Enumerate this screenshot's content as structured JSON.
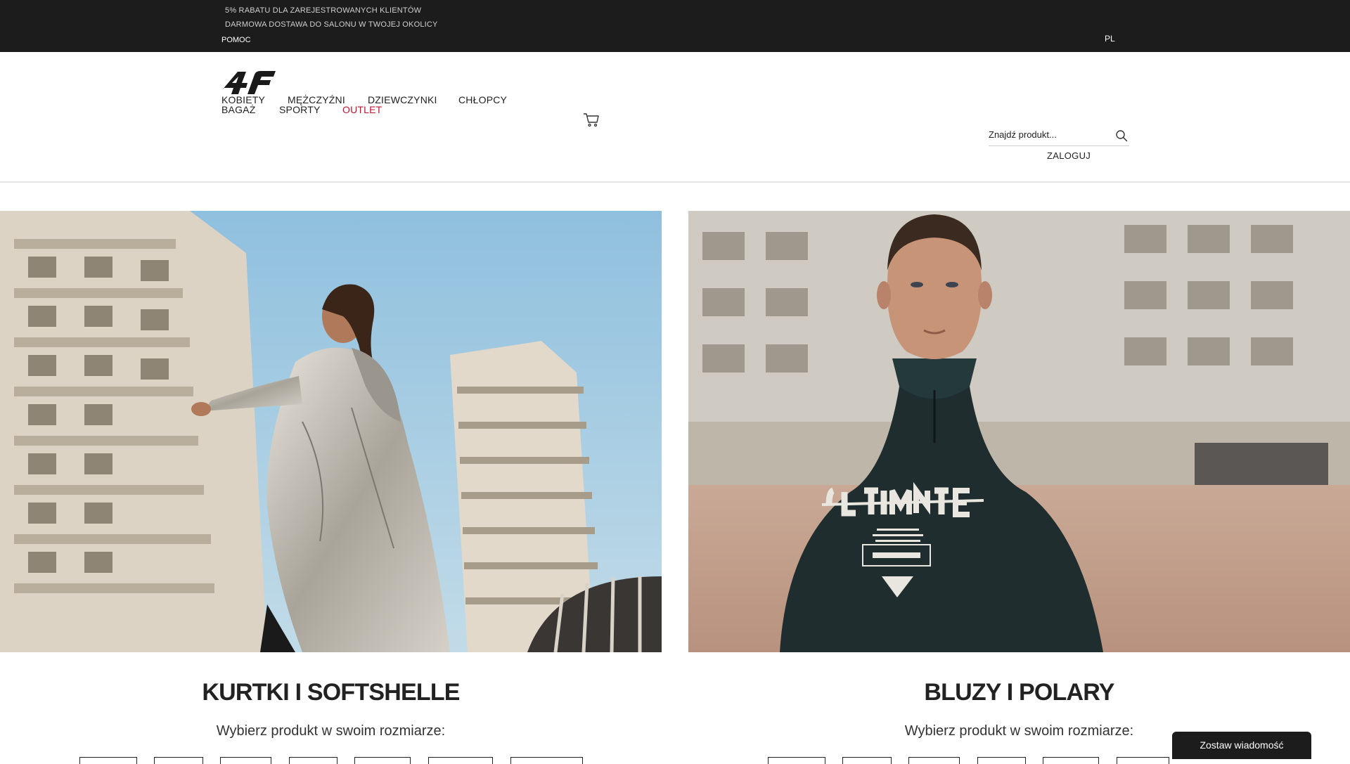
{
  "topbar": {
    "promo_line_1": "5% RABATU DLA ZAREJESTROWANYCH KLIENTÓW",
    "promo_line_2": "DARMOWA DOSTAWA DO SALONU W TWOJEJ OKOLICY",
    "help_label": "POMOC",
    "language": "PL"
  },
  "header": {
    "logo_icon": "4f-logo",
    "nav": {
      "women": "KOBIETY",
      "men": "MĘŻCZYŹNI",
      "girls": "DZIEWCZYNKI",
      "boys": "CHŁOPCY",
      "luggage": "BAGAŻ",
      "sports": "SPORTY",
      "outlet": "OUTLET"
    },
    "cart_icon": "cart-icon",
    "search": {
      "placeholder": "Znajdź produkt...",
      "icon": "search-icon"
    },
    "login_label": "ZALOGUJ"
  },
  "categories": [
    {
      "title": "KURTKI I SOFTSHELLE",
      "subtitle": "Wybierz produkt w swoim rozmiarze:"
    },
    {
      "title": "BLUZY I POLARY",
      "subtitle": "Wybierz produkt w swoim rozmiarze:"
    }
  ],
  "colors": {
    "topbar_bg": "#1c1c1c",
    "outlet_accent": "#c8102e"
  },
  "chat": {
    "label": "Zostaw wiadomość"
  }
}
